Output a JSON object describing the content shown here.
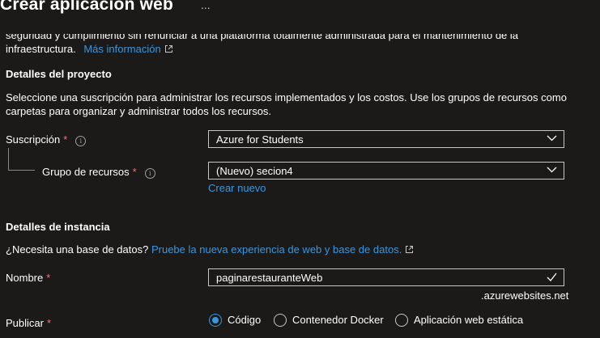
{
  "header": {
    "title": "Crear aplicación web",
    "more": "..."
  },
  "intro": {
    "cut_line": "seguridad y cumplimiento sin renunciar a una plataforma totalmente administrada para el mantenimiento de la",
    "line2": "infraestructura.",
    "more_info_link": "Más información"
  },
  "project": {
    "heading": "Detalles del proyecto",
    "description_line1": "Seleccione una suscripción para administrar los recursos implementados y los costos. Use los grupos de recursos como",
    "description_line2": "carpetas para organizar y administrar todos los recursos.",
    "subscription_label": "Suscripción",
    "subscription_value": "Azure for Students",
    "resource_group_label": "Grupo de recursos",
    "resource_group_value": "(Nuevo) secion4",
    "create_new_link": "Crear nuevo"
  },
  "instance": {
    "heading": "Detalles de instancia",
    "db_question": "¿Necesita una base de datos?",
    "db_link": "Pruebe la nueva experiencia de web y base de datos.",
    "name_label": "Nombre",
    "name_value": "paginarestauranteWeb",
    "name_suffix": ".azurewebsites.net",
    "publish_label": "Publicar",
    "publish_options": [
      "Código",
      "Contenedor Docker",
      "Aplicación web estática"
    ],
    "publish_selected": "Código"
  },
  "required_marker": "*",
  "info_glyph": "i",
  "colors": {
    "background": "#1b1a19",
    "link": "#3a96dd",
    "required": "#f1707b",
    "border": "#c8c6c4"
  },
  "icons": [
    "external-link-icon",
    "info-icon",
    "chevron-down-icon",
    "checkmark-icon"
  ]
}
